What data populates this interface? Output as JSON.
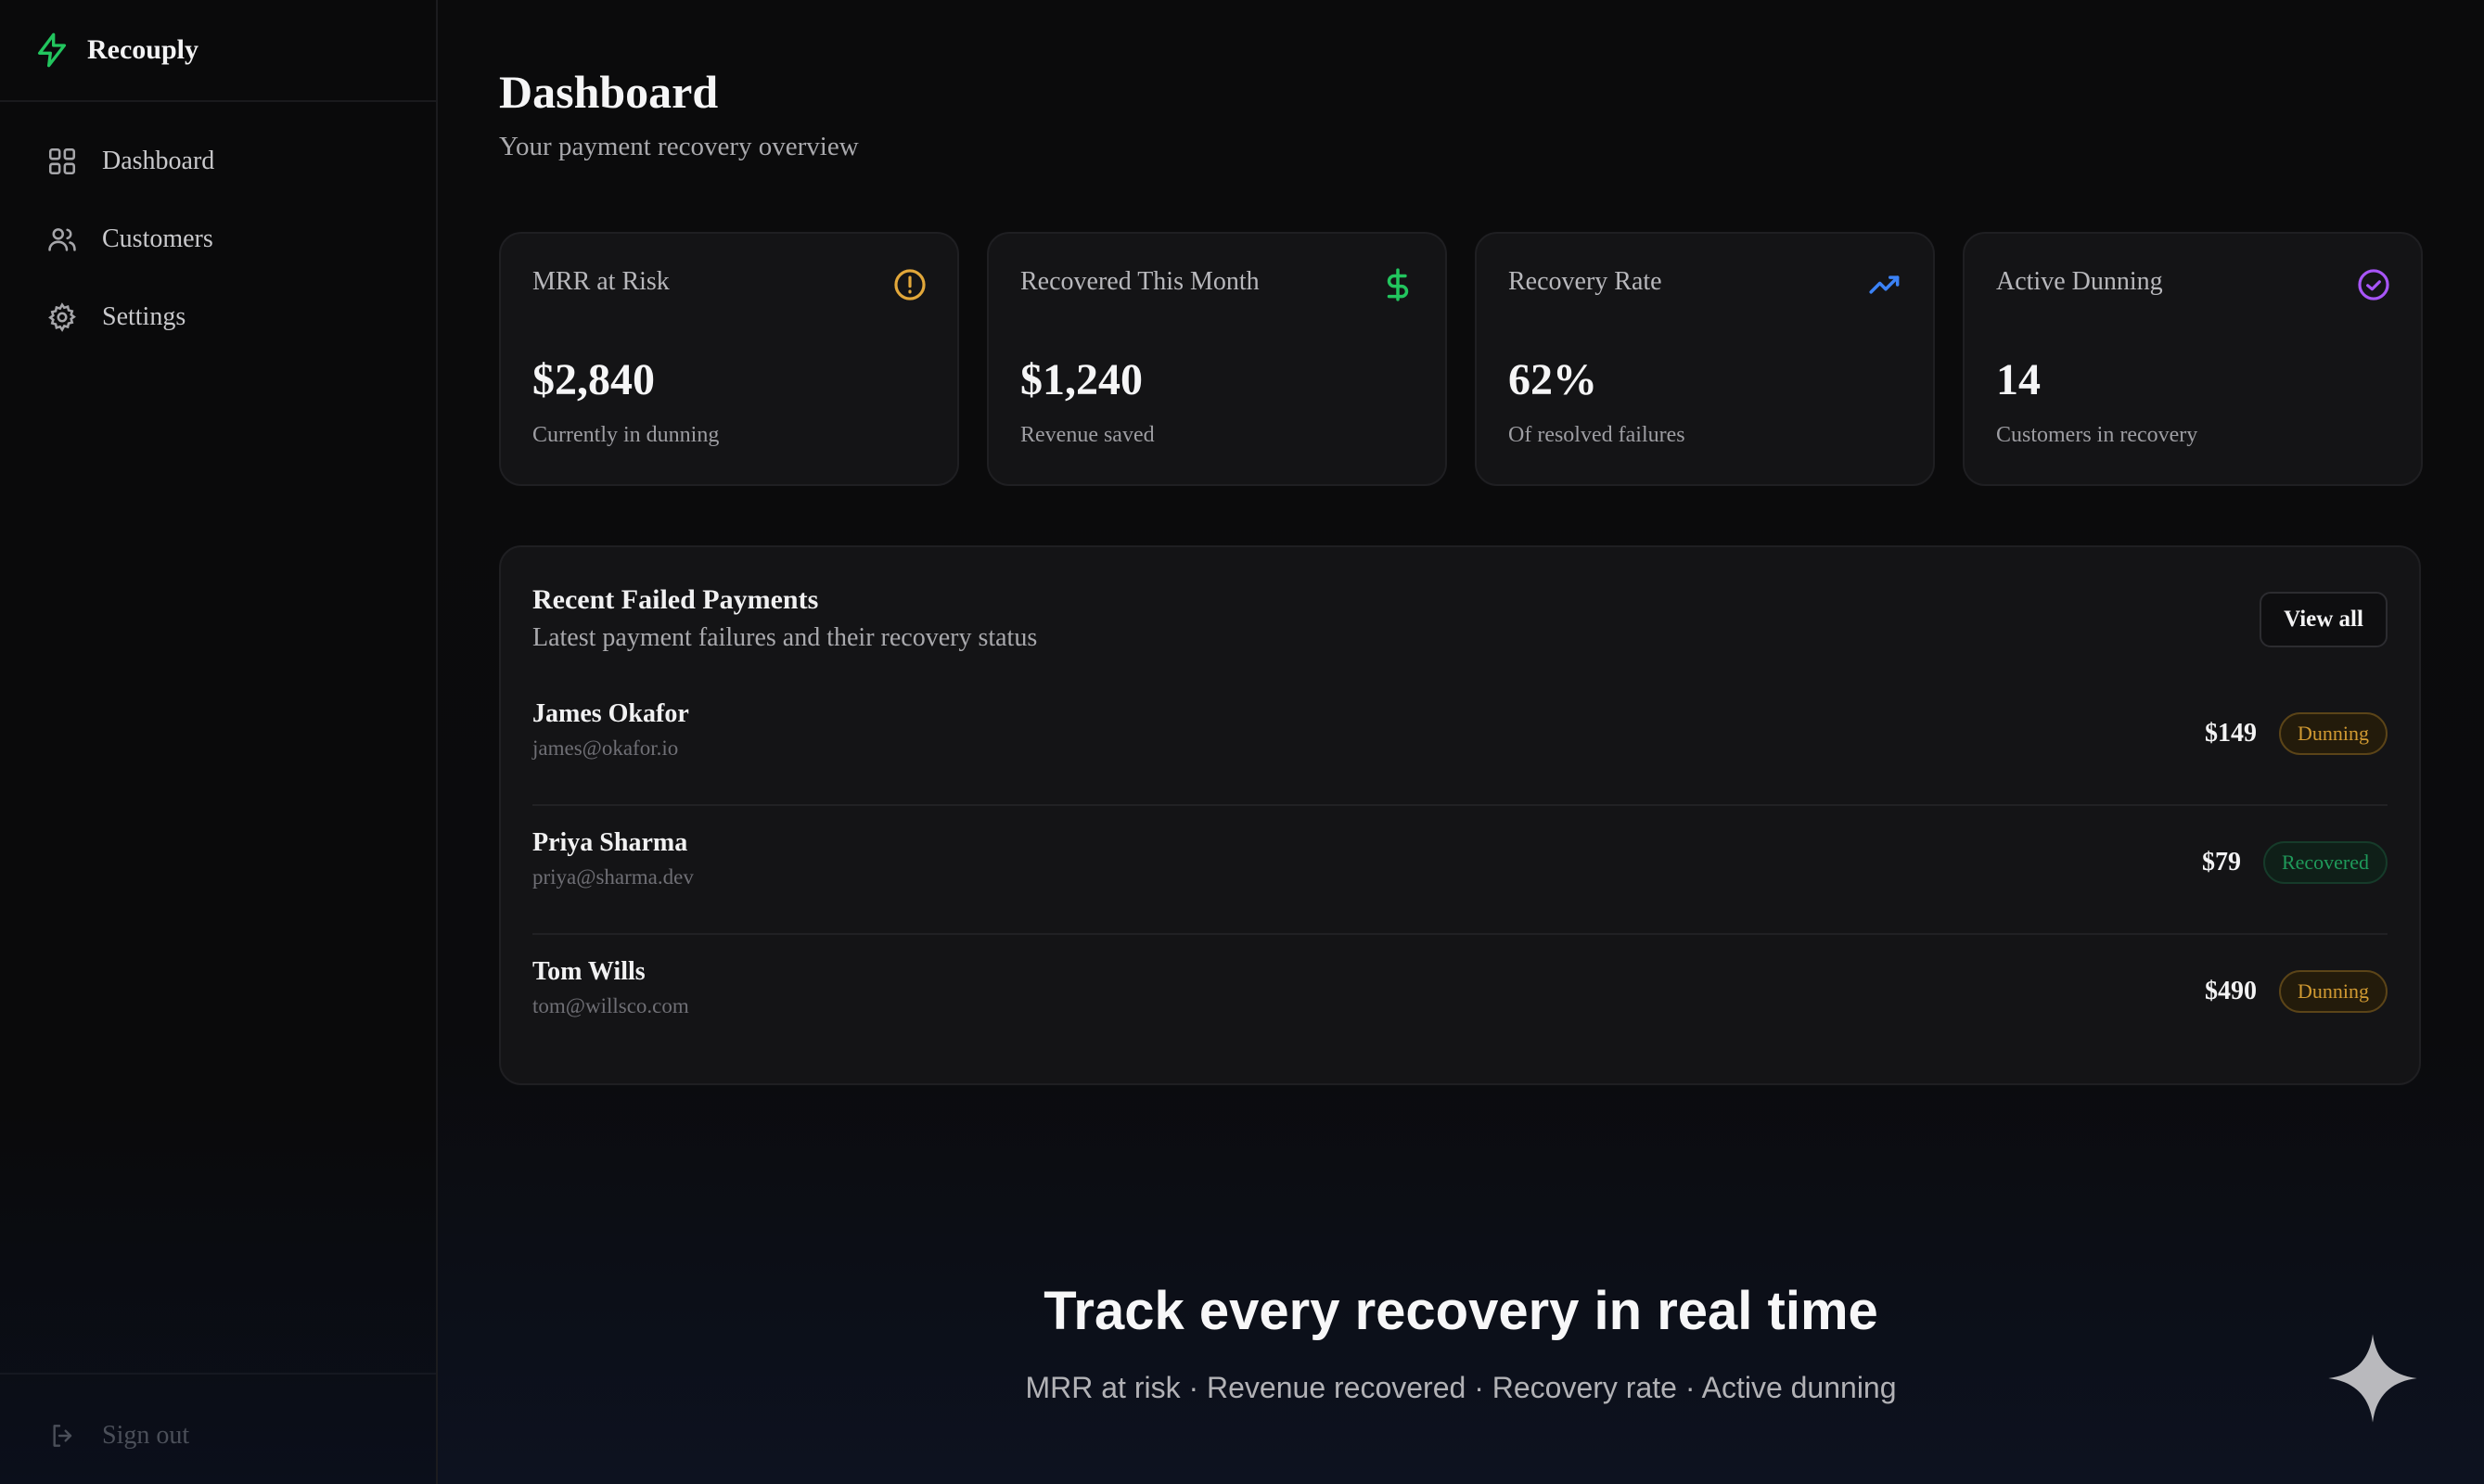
{
  "brand": {
    "name": "Recouply",
    "accent": "#22c55e"
  },
  "sidebar": {
    "items": [
      {
        "label": "Dashboard",
        "icon": "grid-icon"
      },
      {
        "label": "Customers",
        "icon": "users-icon"
      },
      {
        "label": "Settings",
        "icon": "gear-icon"
      }
    ],
    "signout_label": "Sign out"
  },
  "header": {
    "title": "Dashboard",
    "subtitle": "Your payment recovery overview"
  },
  "stats": [
    {
      "label": "MRR at Risk",
      "value": "$2,840",
      "sub": "Currently in dunning",
      "icon": "alert-circle-icon",
      "color": "#e3a83a"
    },
    {
      "label": "Recovered This Month",
      "value": "$1,240",
      "sub": "Revenue saved",
      "icon": "dollar-icon",
      "color": "#22c55e"
    },
    {
      "label": "Recovery Rate",
      "value": "62%",
      "sub": "Of resolved failures",
      "icon": "trending-up-icon",
      "color": "#3b82f6"
    },
    {
      "label": "Active Dunning",
      "value": "14",
      "sub": "Customers in recovery",
      "icon": "check-circle-icon",
      "color": "#a855f7"
    }
  ],
  "payments": {
    "title": "Recent Failed Payments",
    "subtitle": "Latest payment failures and their recovery status",
    "view_all_label": "View all",
    "rows": [
      {
        "name": "James Okafor",
        "email": "james@okafor.io",
        "amount": "$149",
        "status": "Dunning"
      },
      {
        "name": "Priya Sharma",
        "email": "priya@sharma.dev",
        "amount": "$79",
        "status": "Recovered"
      },
      {
        "name": "Tom Wills",
        "email": "tom@willsco.com",
        "amount": "$490",
        "status": "Dunning"
      }
    ]
  },
  "promo": {
    "title": "Track every recovery in real time",
    "subtitle": "MRR at risk · Revenue recovered · Recovery rate · Active dunning"
  }
}
